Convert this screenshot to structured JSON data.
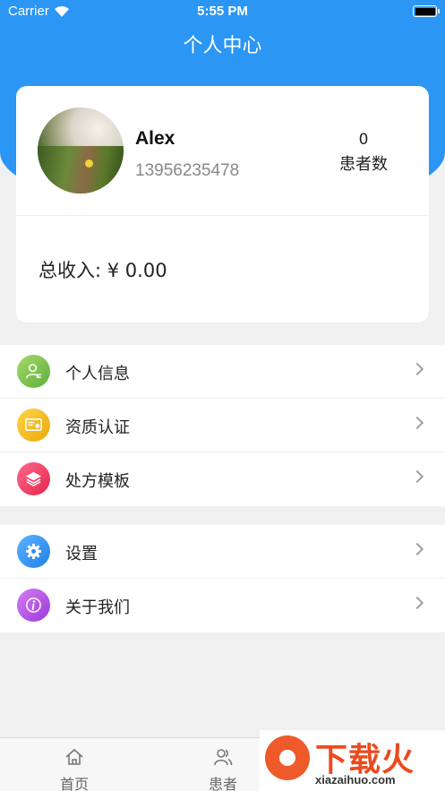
{
  "status_bar": {
    "carrier": "Carrier",
    "time": "5:55 PM"
  },
  "header": {
    "title": "个人中心",
    "accent_color": "#2b96f4"
  },
  "profile": {
    "name": "Alex",
    "phone": "13956235478",
    "patient_count": "0",
    "patient_label": "患者数",
    "income_label": "总收入:",
    "income_value": "¥ 0.00"
  },
  "menu_group_1": [
    {
      "label": "个人信息",
      "icon": "person-info-icon",
      "color": "#7cc24e"
    },
    {
      "label": "资质认证",
      "icon": "certificate-icon",
      "color": "#f2b614"
    },
    {
      "label": "处方模板",
      "icon": "layers-icon",
      "color": "#ef3f6d"
    }
  ],
  "menu_group_2": [
    {
      "label": "设置",
      "icon": "gear-icon",
      "color": "#2c8ef2"
    },
    {
      "label": "关于我们",
      "icon": "info-icon",
      "color": "#b452e8"
    }
  ],
  "tab_bar": [
    {
      "label": "首页",
      "icon": "home-icon"
    },
    {
      "label": "患者",
      "icon": "patients-icon"
    }
  ],
  "watermark": {
    "title": "下载火",
    "url": "xiazaihuo.com"
  }
}
